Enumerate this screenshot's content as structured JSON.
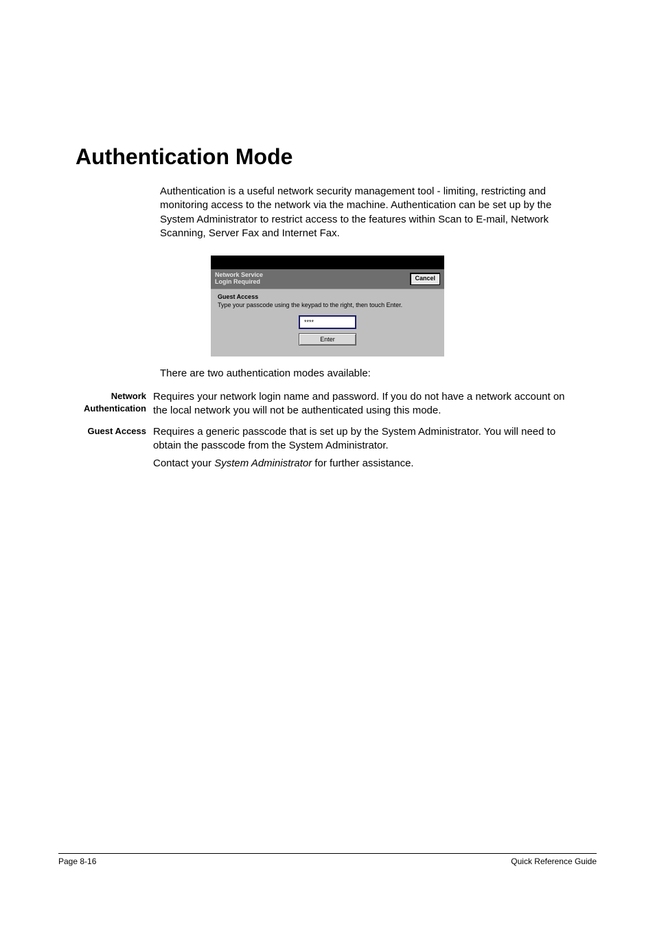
{
  "heading": "Authentication Mode",
  "intro": "Authentication is a useful network security management tool - limiting, restricting and monitoring access to the network via the machine. Authentication can be set up by the System Administrator to restrict access to the features within Scan to E-mail, Network Scanning, Server Fax and Internet Fax.",
  "screenshot": {
    "title_line1": "Network Service",
    "title_line2": "Login Required",
    "cancel": "Cancel",
    "guest_label": "Guest Access",
    "instruction": "Type your passcode using the keypad to the right, then touch Enter.",
    "input_value": "****",
    "enter": "Enter"
  },
  "below_caption": "There are two authentication modes available:",
  "defs": {
    "network": {
      "label_line1": "Network",
      "label_line2": "Authentication",
      "body": "Requires your network login name and password. If you do not have a network account on the local network you will not be authenticated using this mode."
    },
    "guest": {
      "label": "Guest Access",
      "body1": "Requires a generic passcode that is set up by the System Administrator. You will need to obtain the passcode from the System Administrator.",
      "body2_pre": "Contact your ",
      "body2_em": "System Administrator",
      "body2_post": " for further assistance."
    }
  },
  "footer": {
    "left": "Page 8-16",
    "right": "Quick Reference Guide"
  }
}
